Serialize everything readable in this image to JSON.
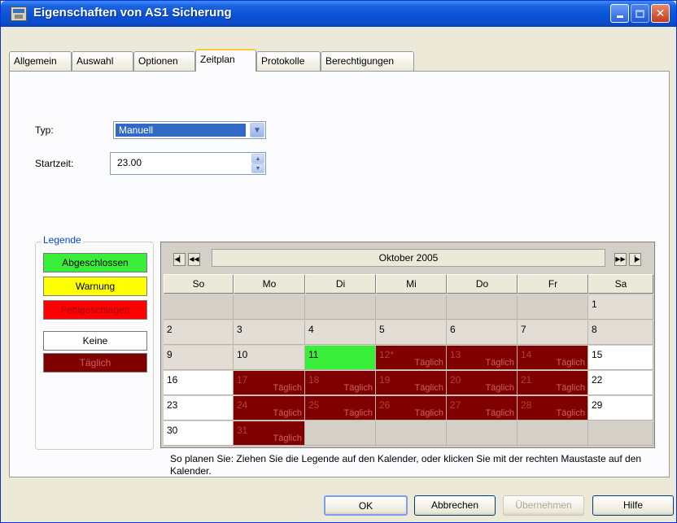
{
  "window": {
    "title": "Eigenschaften von AS1 Sicherung"
  },
  "tabs": [
    {
      "label": "Allgemein"
    },
    {
      "label": "Auswahl"
    },
    {
      "label": "Optionen"
    },
    {
      "label": "Zeitplan"
    },
    {
      "label": "Protokolle"
    },
    {
      "label": "Berechtigungen"
    }
  ],
  "active_tab": "Zeitplan",
  "form": {
    "type_label": "Typ:",
    "type_value": "Manuell",
    "start_label": "Startzeit:",
    "start_value": "23.00"
  },
  "legend": {
    "title": "Legende",
    "items": [
      {
        "label": "Abgeschlossen",
        "color": "#39ee39"
      },
      {
        "label": "Warnung",
        "color": "#ffff00"
      },
      {
        "label": "Fehlgeschlagen",
        "color": "#ff0000"
      },
      {
        "label": "Keine",
        "color": "#ffffff"
      },
      {
        "label": "Täglich",
        "color": "#800000"
      }
    ]
  },
  "calendar": {
    "month": "Oktober 2005",
    "days": [
      "So",
      "Mo",
      "Di",
      "Mi",
      "Do",
      "Fr",
      "Sa"
    ],
    "schedule_label": "Täglich",
    "weeks": [
      [
        {
          "d": ""
        },
        {
          "d": ""
        },
        {
          "d": ""
        },
        {
          "d": ""
        },
        {
          "d": ""
        },
        {
          "d": ""
        },
        {
          "d": "1"
        }
      ],
      [
        {
          "d": "2"
        },
        {
          "d": "3"
        },
        {
          "d": "4"
        },
        {
          "d": "5"
        },
        {
          "d": "6"
        },
        {
          "d": "7"
        },
        {
          "d": "8"
        }
      ],
      [
        {
          "d": "9"
        },
        {
          "d": "10"
        },
        {
          "d": "11",
          "s": "green"
        },
        {
          "d": "12*",
          "s": "red"
        },
        {
          "d": "13",
          "s": "red"
        },
        {
          "d": "14",
          "s": "red"
        },
        {
          "d": "15",
          "s": "white"
        }
      ],
      [
        {
          "d": "16",
          "s": "white"
        },
        {
          "d": "17",
          "s": "red"
        },
        {
          "d": "18",
          "s": "red"
        },
        {
          "d": "19",
          "s": "red"
        },
        {
          "d": "20",
          "s": "red"
        },
        {
          "d": "21",
          "s": "red"
        },
        {
          "d": "22",
          "s": "white"
        }
      ],
      [
        {
          "d": "23",
          "s": "white"
        },
        {
          "d": "24",
          "s": "red"
        },
        {
          "d": "25",
          "s": "red"
        },
        {
          "d": "26",
          "s": "red"
        },
        {
          "d": "27",
          "s": "red"
        },
        {
          "d": "28",
          "s": "red"
        },
        {
          "d": "29",
          "s": "white"
        }
      ],
      [
        {
          "d": "30",
          "s": "white"
        },
        {
          "d": "31",
          "s": "red"
        },
        {
          "d": ""
        },
        {
          "d": ""
        },
        {
          "d": ""
        },
        {
          "d": ""
        },
        {
          "d": ""
        }
      ]
    ]
  },
  "hint": "So planen Sie: Ziehen Sie die Legende auf den Kalender, oder klicken Sie mit der rechten Maustaste auf den Kalender.",
  "buttons": {
    "ok": "OK",
    "cancel": "Abbrechen",
    "apply": "Übernehmen",
    "help": "Hilfe"
  }
}
